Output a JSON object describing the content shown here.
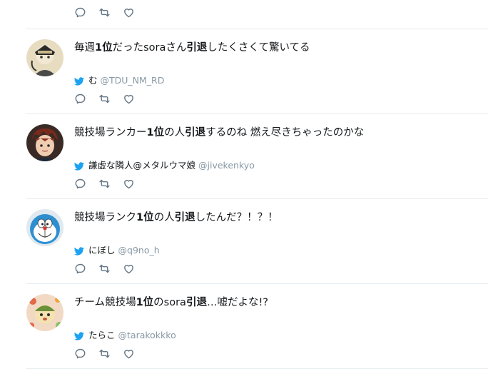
{
  "colors": {
    "text": "#14171a",
    "handle": "#8899a6",
    "twitter_blue": "#1da1f2",
    "icon": "#657786",
    "divider": "#e6ecf0"
  },
  "icons": {
    "reply": "reply-icon",
    "retweet": "retweet-icon",
    "like": "like-icon",
    "source": "twitter-bird-icon"
  },
  "tweets": [
    {
      "text_parts": [
        {
          "text": "毎週",
          "bold": false
        },
        {
          "text": "1位",
          "bold": true
        },
        {
          "text": "だったsoraさん",
          "bold": false
        },
        {
          "text": "引退",
          "bold": true
        },
        {
          "text": "したくさくて驚いてる",
          "bold": false
        }
      ],
      "author_name": "む",
      "author_handle": "@TDU_NM_RD"
    },
    {
      "text_parts": [
        {
          "text": "競技場ランカー",
          "bold": false
        },
        {
          "text": "1位",
          "bold": true
        },
        {
          "text": "の人",
          "bold": false
        },
        {
          "text": "引退",
          "bold": true
        },
        {
          "text": "するのね 燃え尽きちゃったのかな",
          "bold": false
        }
      ],
      "author_name": "謙虚な隣人@メタルウマ娘",
      "author_handle": "@jivekenkyo"
    },
    {
      "text_parts": [
        {
          "text": "競技場ランク",
          "bold": false
        },
        {
          "text": "1位",
          "bold": true
        },
        {
          "text": "の人",
          "bold": false
        },
        {
          "text": "引退",
          "bold": true
        },
        {
          "text": "したんだ？！？！",
          "bold": false
        }
      ],
      "author_name": "にぼし",
      "author_handle": "@q9no_h"
    },
    {
      "text_parts": [
        {
          "text": "チーム競技場",
          "bold": false
        },
        {
          "text": "1位",
          "bold": true
        },
        {
          "text": "のsora",
          "bold": false
        },
        {
          "text": "引退",
          "bold": true
        },
        {
          "text": "…嘘だよな!?",
          "bold": false
        }
      ],
      "author_name": "たらこ",
      "author_handle": "@tarakokkko"
    }
  ]
}
